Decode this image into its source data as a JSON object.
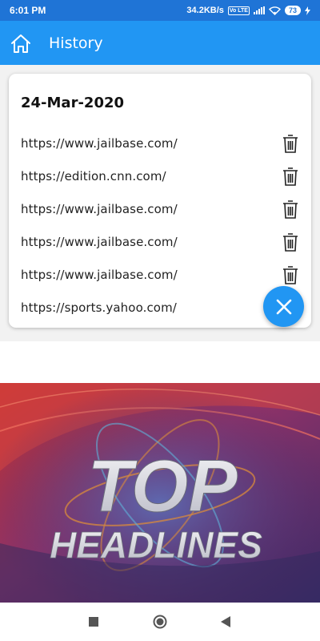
{
  "status_bar": {
    "time": "6:01 PM",
    "network_speed": "34.2KB/s",
    "volte_badge": "Vo LTE",
    "battery_level": "73",
    "icons": [
      "signal-icon",
      "wifi-icon",
      "battery-icon",
      "charging-icon"
    ]
  },
  "app_bar": {
    "title": "History",
    "home_icon": "home-icon",
    "color": "#2196f3"
  },
  "history": {
    "date": "24-Mar-2020",
    "urls": [
      "https://www.jailbase.com/",
      "https://edition.cnn.com/",
      "https://www.jailbase.com/",
      "https://www.jailbase.com/",
      "https://www.jailbase.com/",
      "https://sports.yahoo.com/"
    ],
    "delete_icon": "trash-icon"
  },
  "fab": {
    "icon": "close-icon"
  },
  "banner": {
    "line1": "TOP",
    "line2": "HEADLINES"
  },
  "nav_bar": {
    "icons": [
      "recents-square-icon",
      "home-circle-icon",
      "back-triangle-icon"
    ]
  }
}
